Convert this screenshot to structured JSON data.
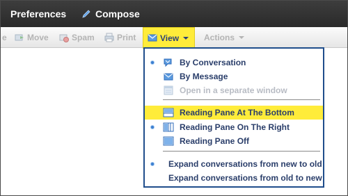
{
  "header": {
    "preferences_label": "Preferences",
    "compose_label": "Compose"
  },
  "toolbar": {
    "move_label": "Move",
    "spam_label": "Spam",
    "print_label": "Print",
    "view_label": "View",
    "actions_label": "Actions"
  },
  "view_menu": {
    "items": [
      {
        "label": "By Conversation",
        "selected": true,
        "icon": "conversation-icon",
        "enabled": true
      },
      {
        "label": "By Message",
        "selected": false,
        "icon": "envelope-icon",
        "enabled": true
      },
      {
        "label": "Open in a separate window",
        "selected": false,
        "icon": "window-icon",
        "enabled": false
      },
      {
        "label": "Reading Pane At The Bottom",
        "selected": false,
        "icon": "pane-bottom-icon",
        "enabled": true,
        "highlighted": true
      },
      {
        "label": "Reading Pane On The Right",
        "selected": true,
        "icon": "pane-right-icon",
        "enabled": true
      },
      {
        "label": "Reading Pane Off",
        "selected": false,
        "icon": "pane-off-icon",
        "enabled": true
      },
      {
        "label": "Expand conversations from new to old",
        "selected": true,
        "enabled": true
      },
      {
        "label": "Expand conversations from old to new",
        "selected": false,
        "enabled": true
      }
    ]
  },
  "colors": {
    "header_bg": "#2f2f2f",
    "highlight": "#ffec3a",
    "menu_border": "#1f4d8b",
    "menu_text": "#2a3e6a",
    "disabled_text": "#b8bcc4"
  }
}
